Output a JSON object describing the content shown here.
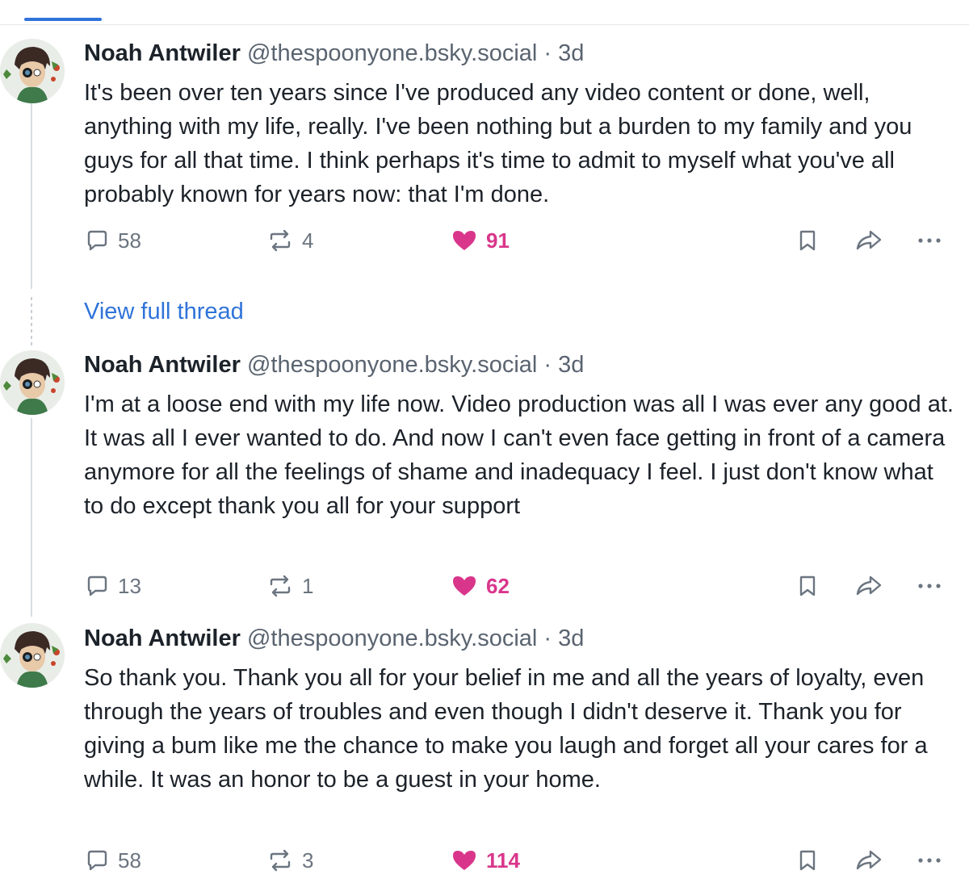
{
  "view_thread": "View full thread",
  "posts": [
    {
      "name": "Noah Antwiler",
      "handle": "@thespoonyone.bsky.social",
      "time": "· 3d",
      "text": "It's been over ten years since I've produced any video content or done, well, anything with my life, really. I've been nothing but a burden to my family and you guys for all that time. I think perhaps it's time to admit to myself what you've all probably known for years now: that I'm done.",
      "replies": "58",
      "reposts": "4",
      "likes": "91"
    },
    {
      "name": "Noah Antwiler",
      "handle": "@thespoonyone.bsky.social",
      "time": "· 3d",
      "text": "I'm at a loose end with my life now. Video production was all I was ever any good at. It was all I ever wanted to do. And now I can't even face getting in front of a camera anymore for all the feelings of shame and inadequacy I feel. I just don't know what to do except thank you all for your support",
      "replies": "13",
      "reposts": "1",
      "likes": "62"
    },
    {
      "name": "Noah Antwiler",
      "handle": "@thespoonyone.bsky.social",
      "time": "· 3d",
      "text": "So thank you. Thank you all for your belief in me and all the years of loyalty, even through the years of troubles and even though I didn't deserve it. Thank you for giving a bum like me the chance to make you laugh and forget all your cares for a while. It was an honor to be a guest in your home.",
      "replies": "58",
      "reposts": "3",
      "likes": "114"
    }
  ],
  "colors": {
    "accent": "#2f73d9",
    "like": "#d9368b",
    "muted": "#6b7580",
    "text": "#1c2229"
  },
  "icons": [
    "reply-icon",
    "repost-icon",
    "heart-icon",
    "bookmark-icon",
    "share-icon",
    "more-icon"
  ]
}
